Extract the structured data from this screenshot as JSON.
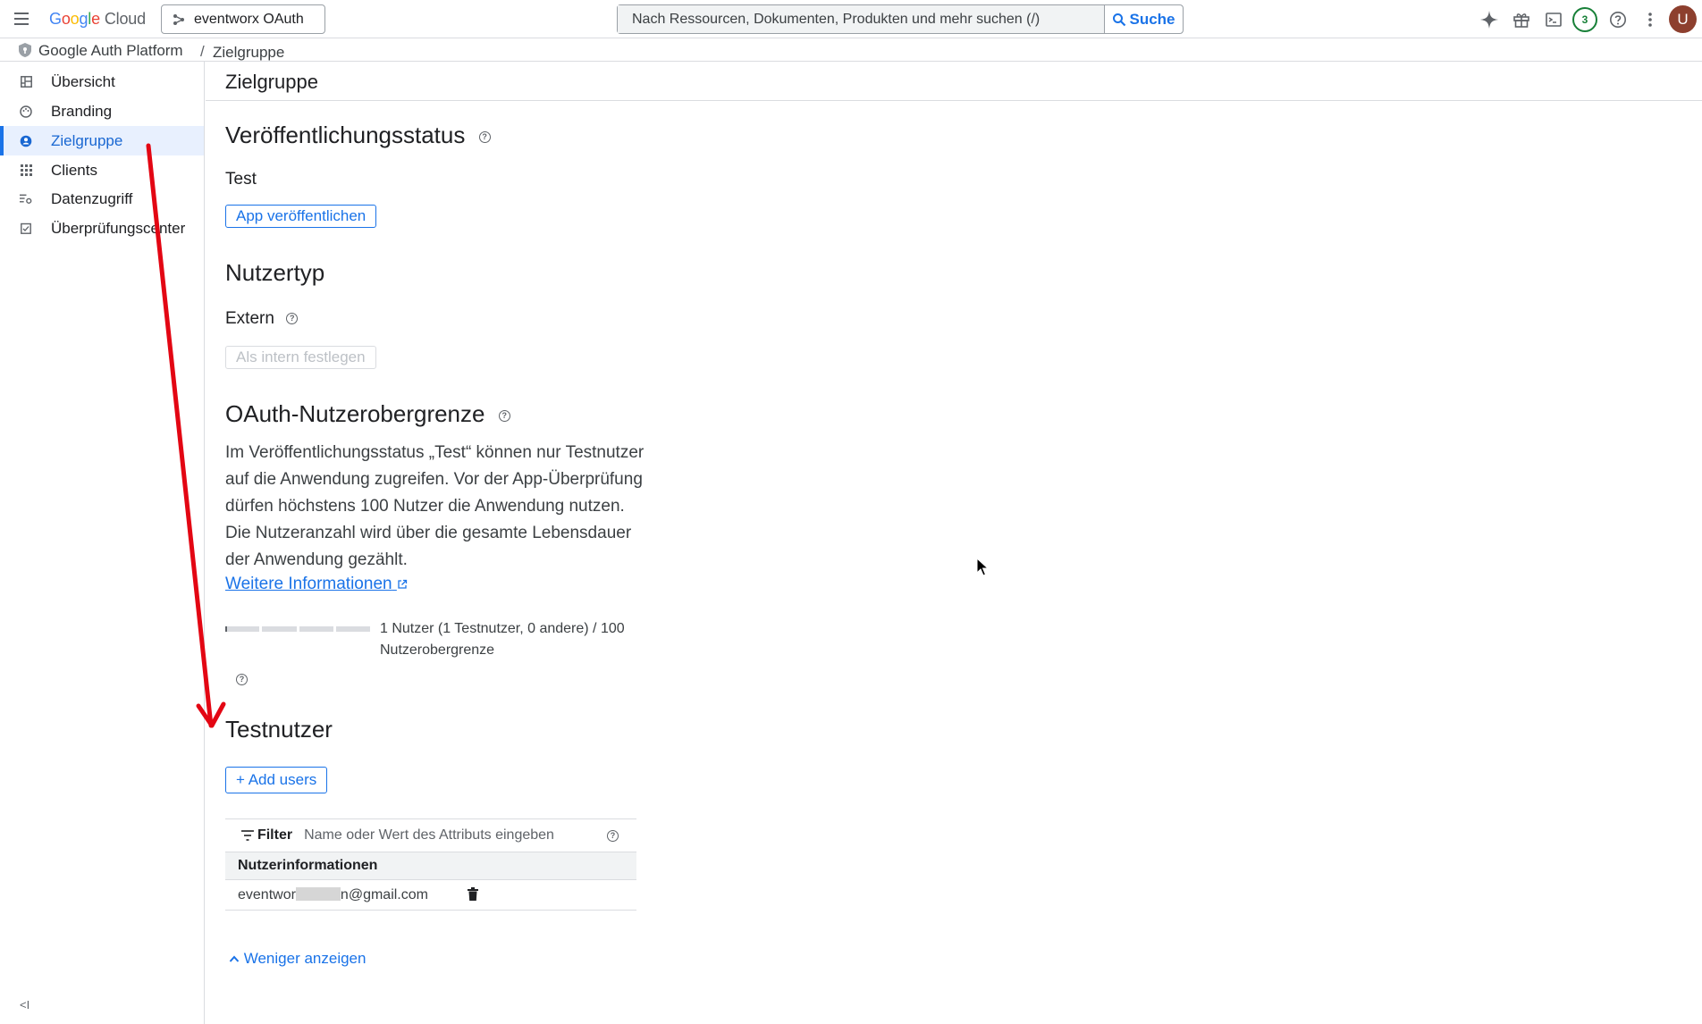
{
  "topbar": {
    "logo_google": "Google",
    "logo_cloud": "Cloud",
    "project": "eventworx OAuth",
    "search_placeholder": "Nach Ressourcen, Dokumenten, Produkten und mehr suchen (/)",
    "search_button": "Suche",
    "notifications_count": "3",
    "avatar_initial": "U"
  },
  "breadcrumb": {
    "product": "Google Auth Platform",
    "separator": "/",
    "page": "Zielgruppe"
  },
  "sidebar": {
    "items": [
      {
        "label": "Übersicht",
        "icon": "dashboard-icon",
        "active": false
      },
      {
        "label": "Branding",
        "icon": "palette-icon",
        "active": false
      },
      {
        "label": "Zielgruppe",
        "icon": "audience-icon",
        "active": true
      },
      {
        "label": "Clients",
        "icon": "apps-grid-icon",
        "active": false
      },
      {
        "label": "Datenzugriff",
        "icon": "data-access-icon",
        "active": false
      },
      {
        "label": "Überprüfungscenter",
        "icon": "verification-icon",
        "active": false
      }
    ],
    "collapse_label": "<I"
  },
  "page": {
    "title": "Zielgruppe",
    "publishing": {
      "heading": "Veröffentlichungsstatus",
      "status": "Test",
      "button": "App veröffentlichen"
    },
    "user_type": {
      "heading": "Nutzertyp",
      "value": "Extern",
      "button": "Als intern festlegen"
    },
    "user_cap": {
      "heading": "OAuth-Nutzerobergrenze",
      "description": "Im Veröffentlichungsstatus „Test“ können nur Testnutzer auf die Anwendung zugreifen. Vor der App-Überprüfung dürfen höchstens 100 Nutzer die Anwendung nutzen. Die Nutzeranzahl wird über die gesamte Lebensdauer der Anwendung gezählt.",
      "link": "Weitere Informationen",
      "usage_text": "1 Nutzer (1 Testnutzer, 0 andere) / 100 Nutzerobergrenze",
      "usage_fraction": 0.01
    },
    "test_users": {
      "heading": "Testnutzer",
      "add_button": "+ Add users",
      "filter_label": "Filter",
      "filter_placeholder": "Name oder Wert des Attributs eingeben",
      "column_header": "Nutzerinformationen",
      "rows": [
        {
          "email_start": "eventwor",
          "email_end": "n@gmail.com"
        }
      ],
      "show_less": "Weniger anzeigen"
    }
  },
  "colors": {
    "accent": "#1a73e8",
    "annotation_arrow": "#e30613",
    "nav_active_bg": "#e8f0fe"
  }
}
